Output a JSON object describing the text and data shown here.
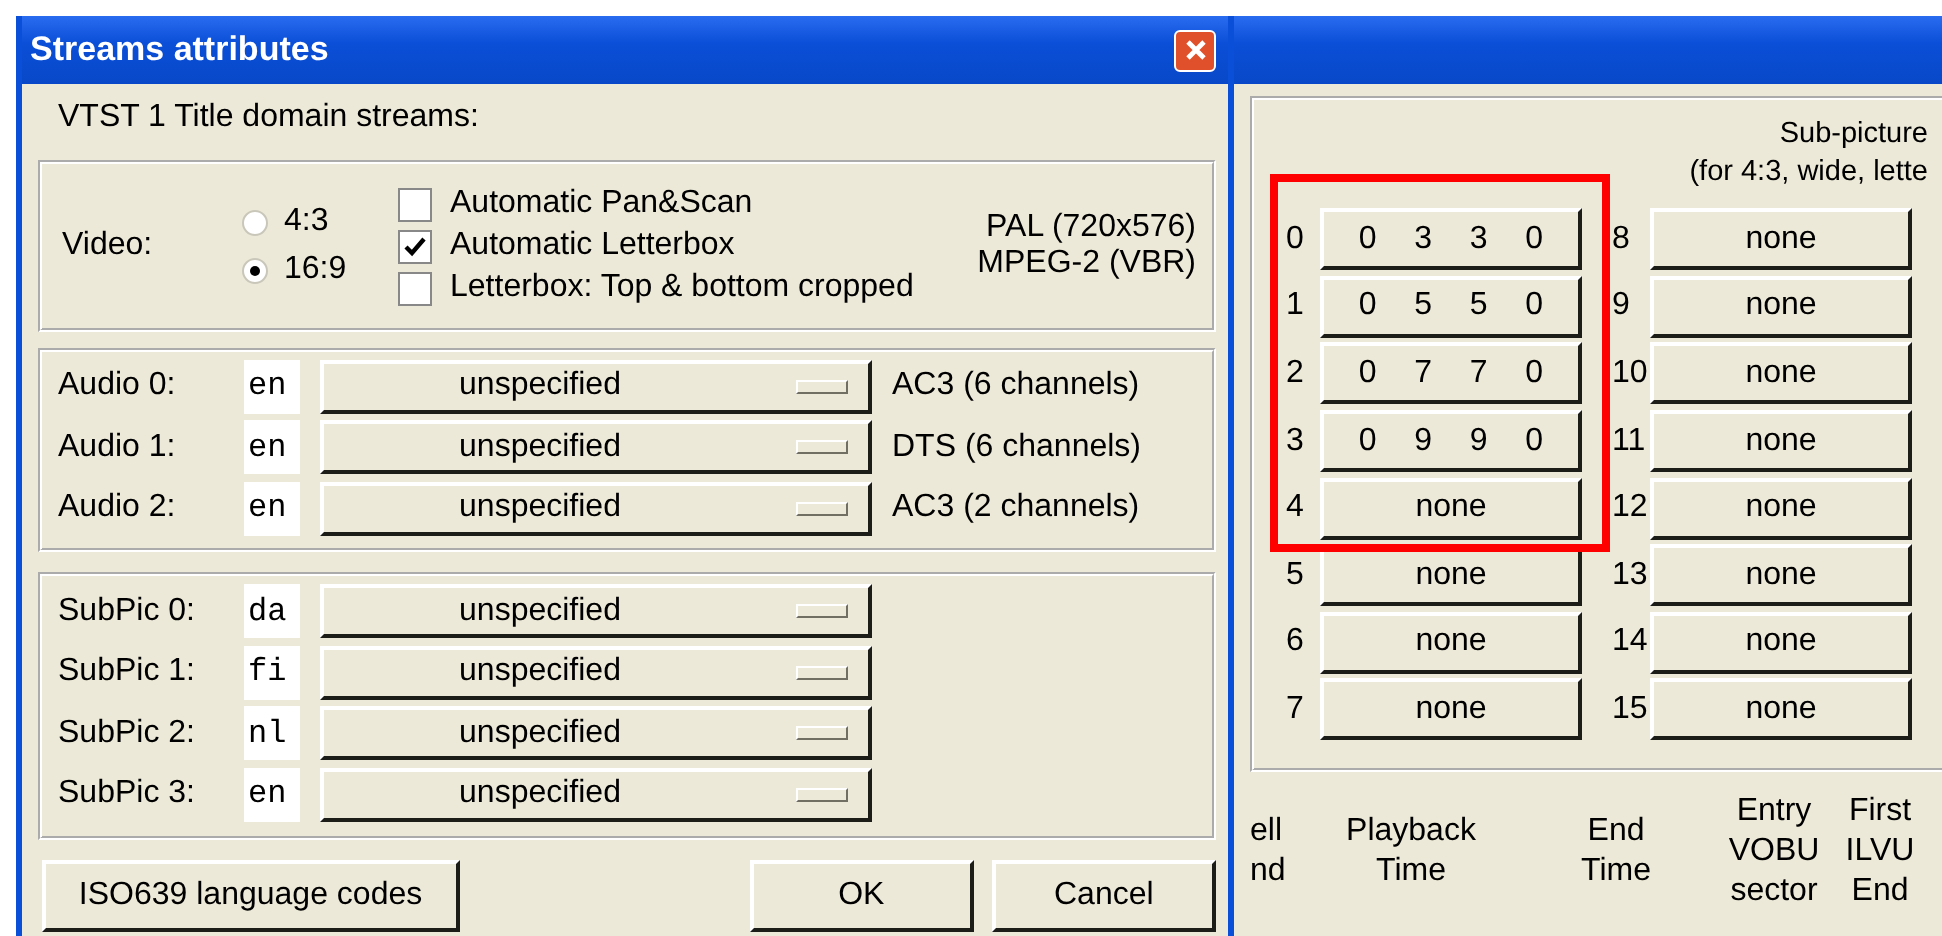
{
  "dialog": {
    "title": "Streams attributes",
    "heading": "VTST 1 Title domain streams:",
    "video": {
      "label": "Video:",
      "aspects": [
        {
          "label": "4:3",
          "selected": false
        },
        {
          "label": "16:9",
          "selected": true
        }
      ],
      "options": [
        {
          "label": "Automatic Pan&Scan",
          "checked": false
        },
        {
          "label": "Automatic Letterbox",
          "checked": true
        },
        {
          "label": "Letterbox: Top & bottom cropped",
          "checked": false
        }
      ],
      "info": [
        "PAL (720x576)",
        "MPEG-2 (VBR)"
      ]
    },
    "audio": [
      {
        "label": "Audio 0:",
        "lang": "en",
        "mode": "unspecified",
        "format": "AC3 (6 channels)"
      },
      {
        "label": "Audio 1:",
        "lang": "en",
        "mode": "unspecified",
        "format": "DTS (6 channels)"
      },
      {
        "label": "Audio 2:",
        "lang": "en",
        "mode": "unspecified",
        "format": "AC3 (2 channels)"
      }
    ],
    "subpics": [
      {
        "label": "SubPic 0:",
        "lang": "da",
        "mode": "unspecified"
      },
      {
        "label": "SubPic 1:",
        "lang": "fi",
        "mode": "unspecified"
      },
      {
        "label": "SubPic 2:",
        "lang": "nl",
        "mode": "unspecified"
      },
      {
        "label": "SubPic 3:",
        "lang": "en",
        "mode": "unspecified"
      }
    ],
    "buttons": [
      {
        "kind": "codes",
        "label": "ISO639 language codes"
      },
      {
        "kind": "ok",
        "label": "OK"
      },
      {
        "kind": "cancel",
        "label": "Cancel"
      }
    ]
  },
  "background_window": {
    "heading": [
      "Sub-picture",
      "(for 4:3, wide, lette"
    ],
    "slots": [
      {
        "index": "0",
        "parts": [
          "0",
          "3",
          "3",
          "0"
        ]
      },
      {
        "index": "1",
        "parts": [
          "0",
          "5",
          "5",
          "0"
        ]
      },
      {
        "index": "2",
        "parts": [
          "0",
          "7",
          "7",
          "0"
        ]
      },
      {
        "index": "3",
        "parts": [
          "0",
          "9",
          "9",
          "0"
        ]
      },
      {
        "index": "4",
        "parts": [
          "none"
        ]
      },
      {
        "index": "5",
        "parts": [
          "none"
        ]
      },
      {
        "index": "6",
        "parts": [
          "none"
        ]
      },
      {
        "index": "7",
        "parts": [
          "none"
        ]
      },
      {
        "index": "8",
        "parts": [
          "none"
        ]
      },
      {
        "index": "9",
        "parts": [
          "none"
        ]
      },
      {
        "index": "10",
        "parts": [
          "none"
        ]
      },
      {
        "index": "11",
        "parts": [
          "none"
        ]
      },
      {
        "index": "12",
        "parts": [
          "none"
        ]
      },
      {
        "index": "13",
        "parts": [
          "none"
        ]
      },
      {
        "index": "14",
        "parts": [
          "none"
        ]
      },
      {
        "index": "15",
        "parts": [
          "none"
        ]
      }
    ],
    "columns": [
      [
        "ell",
        "nd"
      ],
      [
        "Playback",
        "Time"
      ],
      [
        "End",
        "Time"
      ],
      [
        "Entry",
        "VOBU",
        "sector"
      ],
      [
        "First",
        "ILVU",
        "End"
      ]
    ]
  }
}
